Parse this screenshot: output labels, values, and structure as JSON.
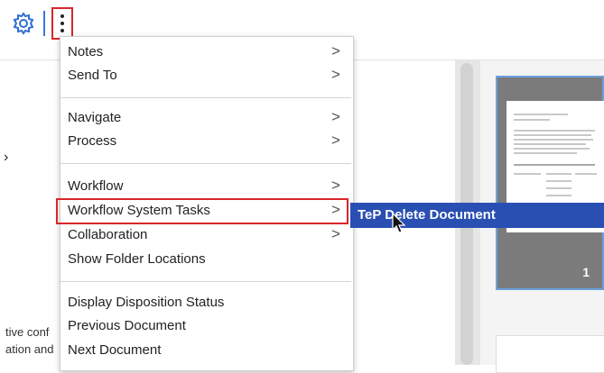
{
  "toolbar": {
    "settings_icon": "gear-icon",
    "more_icon": "kebab-icon"
  },
  "menu": {
    "groups": [
      [
        {
          "label": "Notes",
          "submenu": true
        },
        {
          "label": "Send To",
          "submenu": true
        }
      ],
      [
        {
          "label": "Navigate",
          "submenu": true
        },
        {
          "label": "Process",
          "submenu": true
        }
      ],
      [
        {
          "label": "Workflow",
          "submenu": true
        },
        {
          "label": "Workflow System Tasks",
          "submenu": true
        },
        {
          "label": "Collaboration",
          "submenu": true
        },
        {
          "label": "Show Folder Locations",
          "submenu": false
        }
      ],
      [
        {
          "label": "Display Disposition Status",
          "submenu": false
        },
        {
          "label": "Previous Document",
          "submenu": false
        },
        {
          "label": "Next Document",
          "submenu": false
        }
      ]
    ],
    "highlighted_item": "Workflow System Tasks"
  },
  "submenu": {
    "items": [
      {
        "label": "TeP Delete Document"
      }
    ]
  },
  "document": {
    "line1": "tive conf",
    "line2": "ation and"
  },
  "thumbnails": [
    {
      "page": "1",
      "selected": true
    }
  ],
  "colors": {
    "highlight": "#2a4fb3",
    "annotation_red": "#d9262b",
    "accent_blue": "#3a78d6"
  }
}
